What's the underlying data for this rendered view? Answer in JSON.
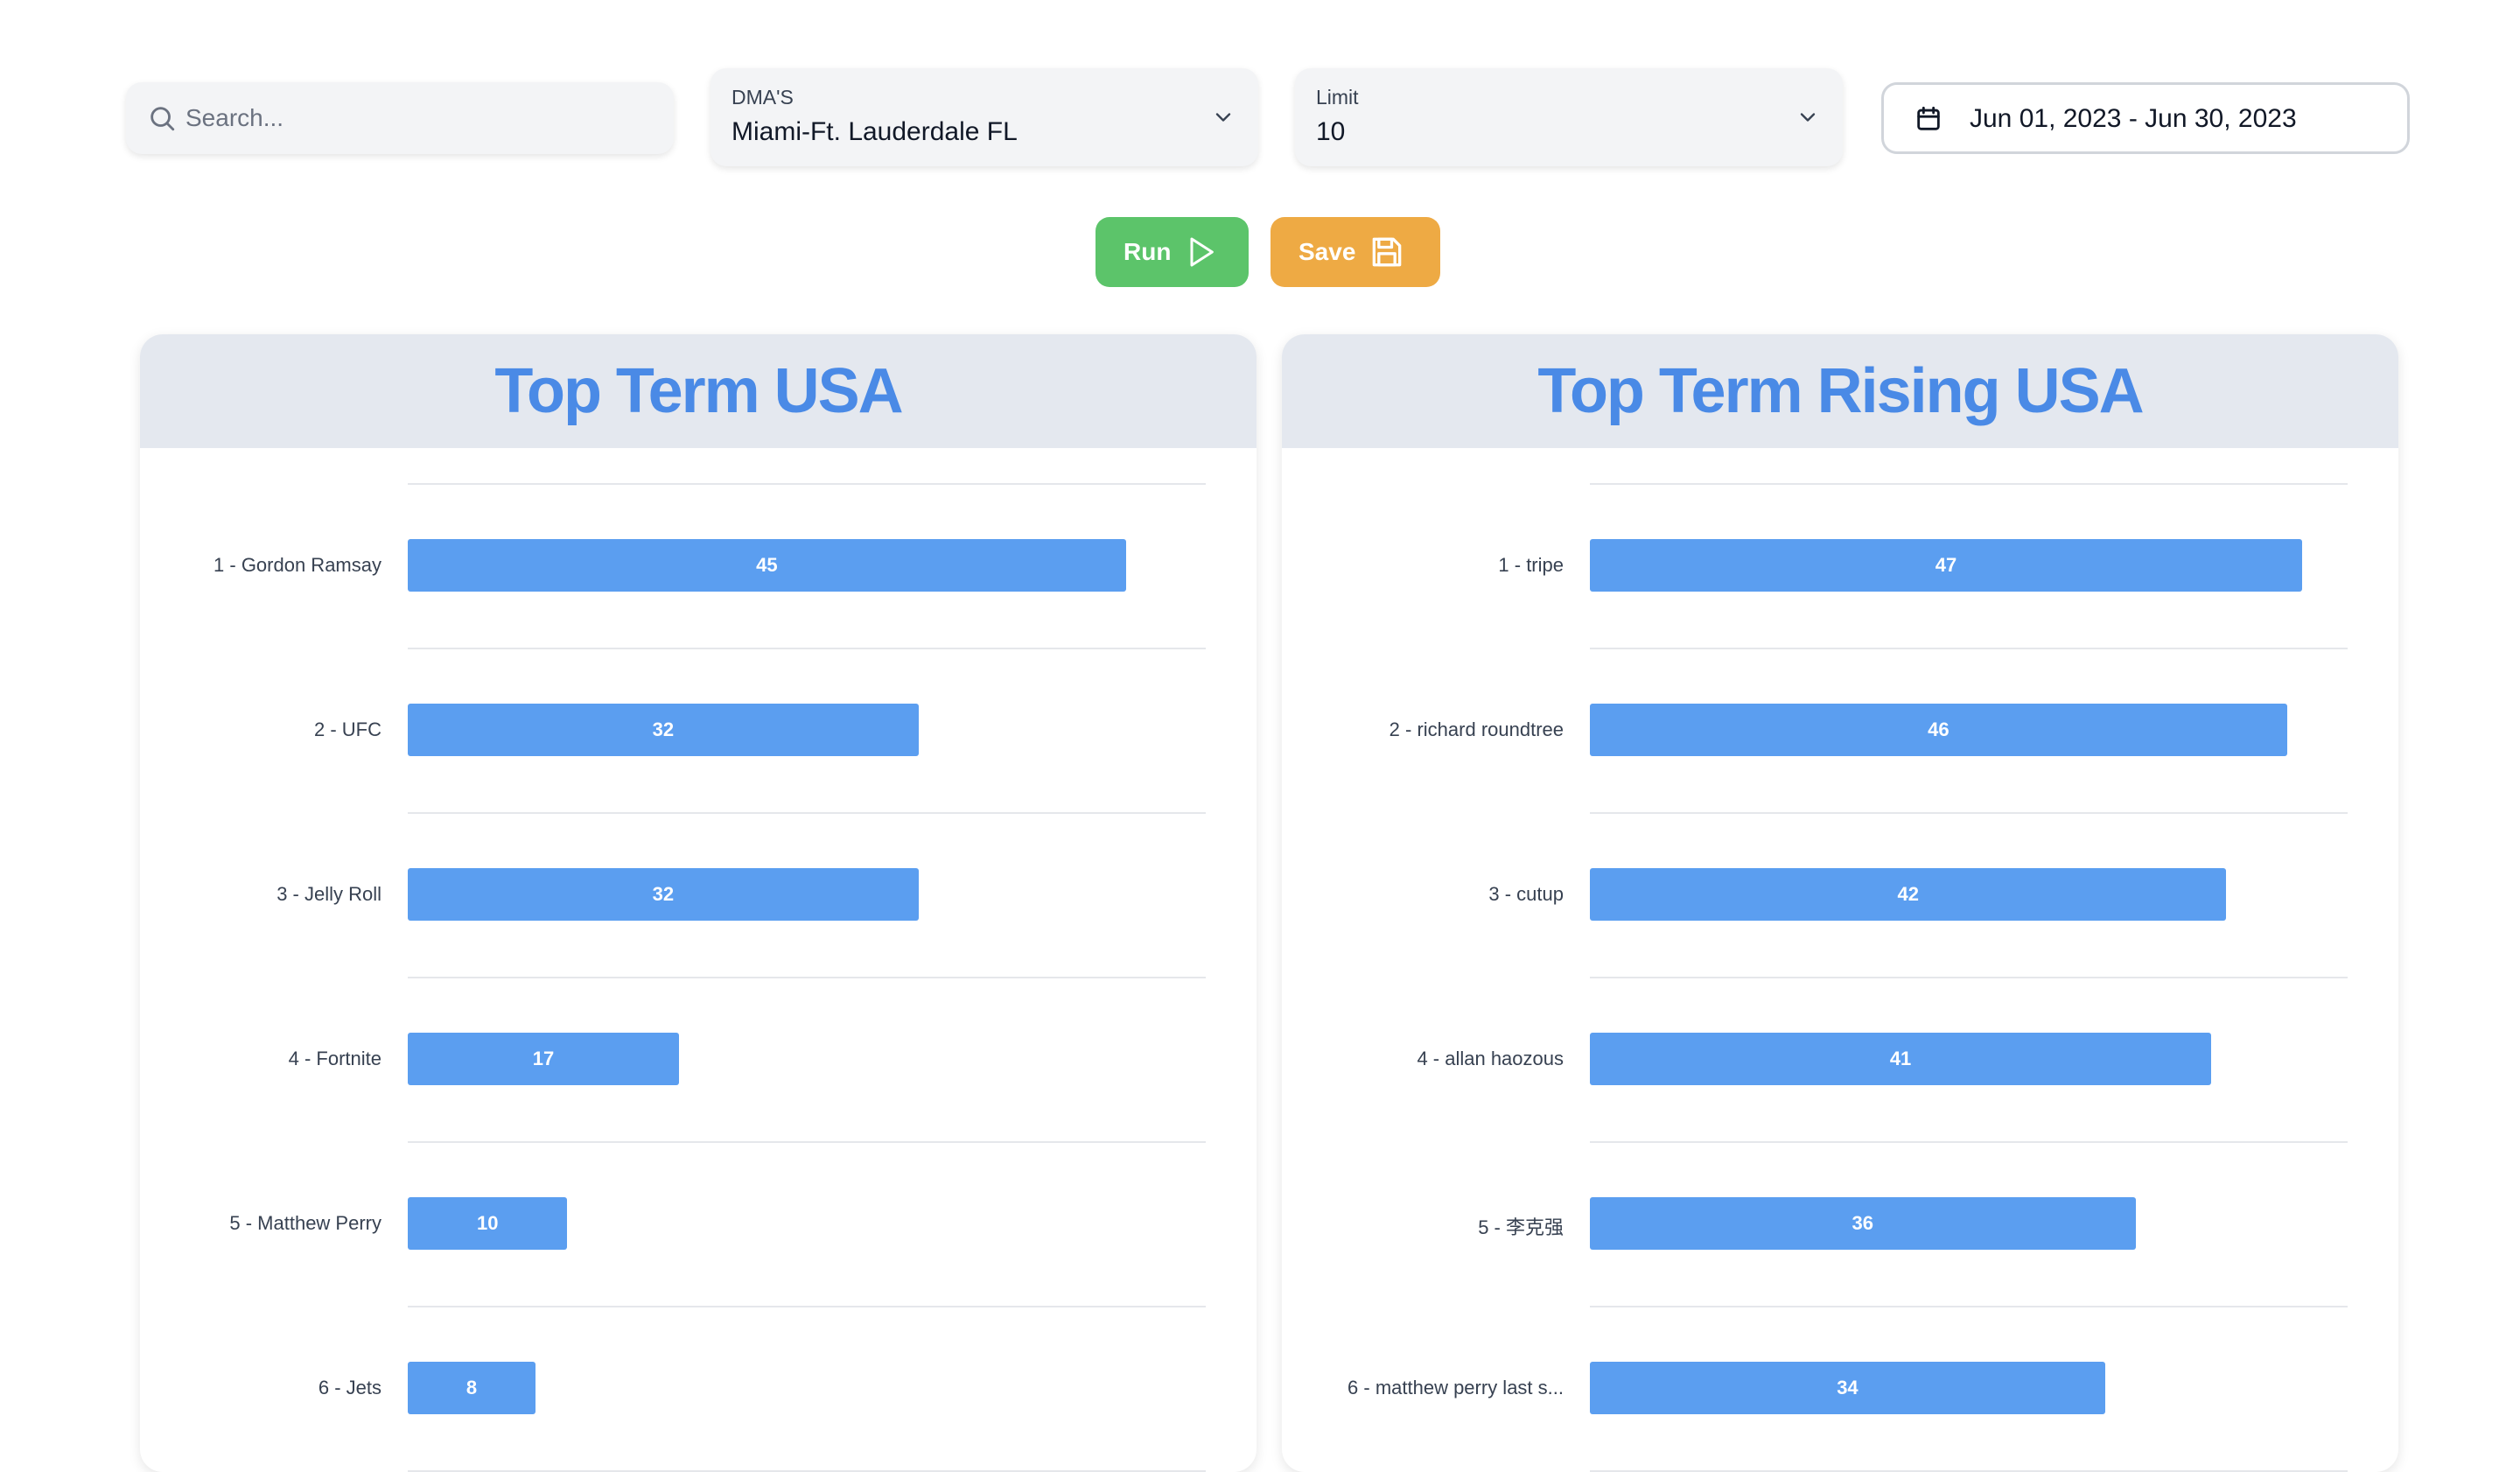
{
  "search": {
    "placeholder": "Search..."
  },
  "filters": {
    "dma": {
      "label": "DMA'S",
      "value": "Miami-Ft. Lauderdale FL"
    },
    "limit": {
      "label": "Limit",
      "value": "10"
    },
    "date_range": "Jun 01, 2023 - Jun 30, 2023"
  },
  "actions": {
    "run_label": "Run",
    "save_label": "Save"
  },
  "colors": {
    "bar": "#5b9ef0",
    "title": "#4a8ae6",
    "run": "#5cc46a",
    "save": "#eeaa44"
  },
  "chart_data": [
    {
      "type": "bar",
      "orientation": "horizontal",
      "title": "Top Term USA",
      "categories": [
        "1 - Gordon Ramsay",
        "2 - UFC",
        "3 - Jelly Roll",
        "4 - Fortnite",
        "5 - Matthew Perry",
        "6 - Jets"
      ],
      "values": [
        45,
        32,
        32,
        17,
        10,
        8
      ],
      "xlim": [
        0,
        50
      ],
      "grid": true
    },
    {
      "type": "bar",
      "orientation": "horizontal",
      "title": "Top Term Rising USA",
      "categories": [
        "1 - tripe",
        "2 - richard roundtree",
        "3 - cutup",
        "4 - allan haozous",
        "5 - 李克强",
        "6 - matthew perry last s..."
      ],
      "values": [
        47,
        46,
        42,
        41,
        36,
        34
      ],
      "xlim": [
        0,
        50
      ],
      "grid": true
    }
  ]
}
